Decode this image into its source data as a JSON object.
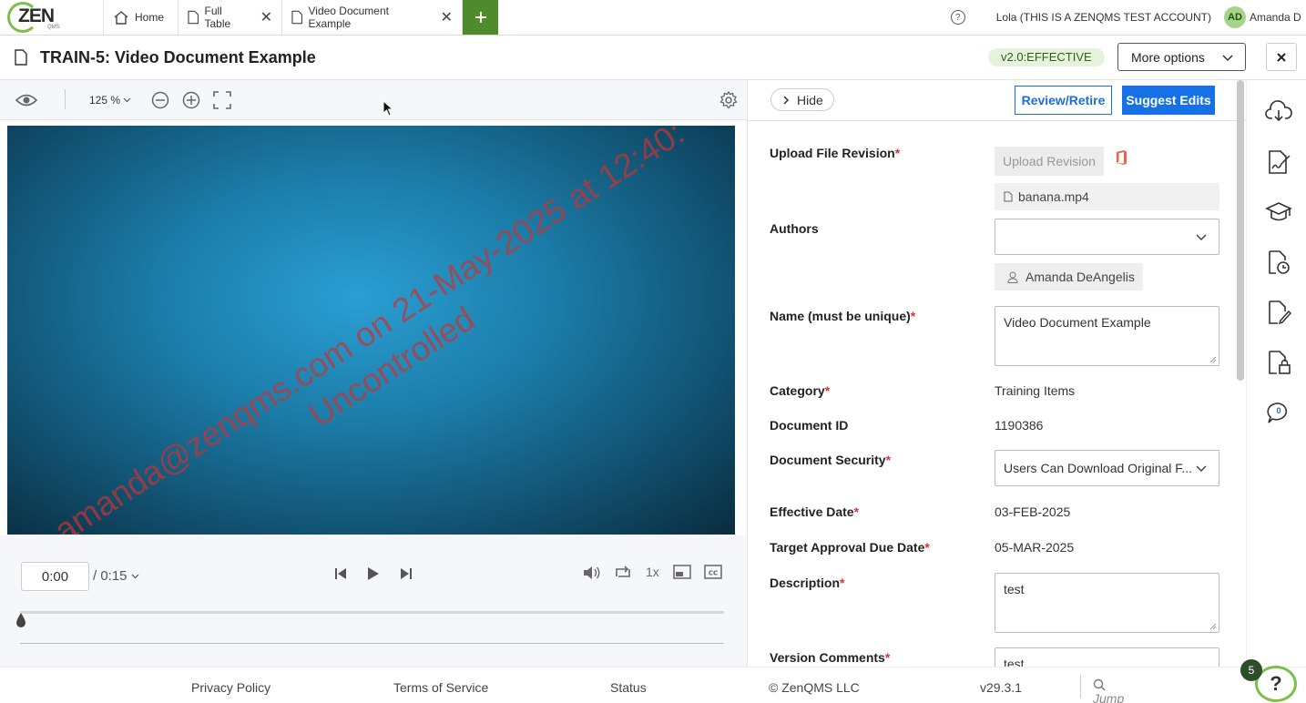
{
  "app": {
    "logo_text": "ZEN",
    "logo_sub": "QMS"
  },
  "tabs": [
    {
      "label": "Home"
    },
    {
      "label": "Full Table"
    },
    {
      "label": "Video Document Example"
    }
  ],
  "account": {
    "label": "Lola (THIS IS A ZENQMS TEST ACCOUNT)",
    "initials": "AD",
    "name": "Amanda D"
  },
  "document": {
    "title": "TRAIN-5: Video Document Example",
    "version": "v2.0:EFFECTIVE",
    "more_options": "More options"
  },
  "viewer": {
    "zoom": "125 %",
    "watermark_line1": "amanda@zenqms.com on 21-May-2025 at 12:40:",
    "watermark_line2": "Uncontrolled"
  },
  "player": {
    "current_time": "0:00",
    "duration": "/ 0:15",
    "speed": "1x",
    "progress": 0
  },
  "panel": {
    "hide": "Hide",
    "review_retire": "Review/Retire",
    "suggest_edits": "Suggest Edits",
    "fields": {
      "upload_label": "Upload File Revision",
      "upload_button": "Upload Revision",
      "file_name": "banana.mp4",
      "authors_label": "Authors",
      "authors_value": "",
      "author_chip": "Amanda DeAngelis",
      "name_label": "Name (must be unique)",
      "name_value": "Video Document Example",
      "category_label": "Category",
      "category_value": "Training Items",
      "docid_label": "Document ID",
      "docid_value": "1190386",
      "security_label": "Document Security",
      "security_value": "Users Can Download Original F...",
      "effective_label": "Effective Date",
      "effective_value": "03-FEB-2025",
      "target_label": "Target Approval Due Date",
      "target_value": "05-MAR-2025",
      "description_label": "Description",
      "description_value": "test",
      "comments_label": "Version Comments",
      "comments_value": "test"
    },
    "required_mark": "*"
  },
  "rail": {
    "comments_count": "0"
  },
  "footer": {
    "privacy": "Privacy Policy",
    "terms": "Terms of Service",
    "status": "Status",
    "copyright": "© ZenQMS LLC",
    "version": "v29.3.1",
    "qsheet_placeholder": "Jump to Qsheet",
    "notification_count": "5",
    "help": "?"
  },
  "colors": {
    "brand_green": "#7cbf4a",
    "primary_blue": "#1771e6",
    "required_red": "#dd3333"
  }
}
